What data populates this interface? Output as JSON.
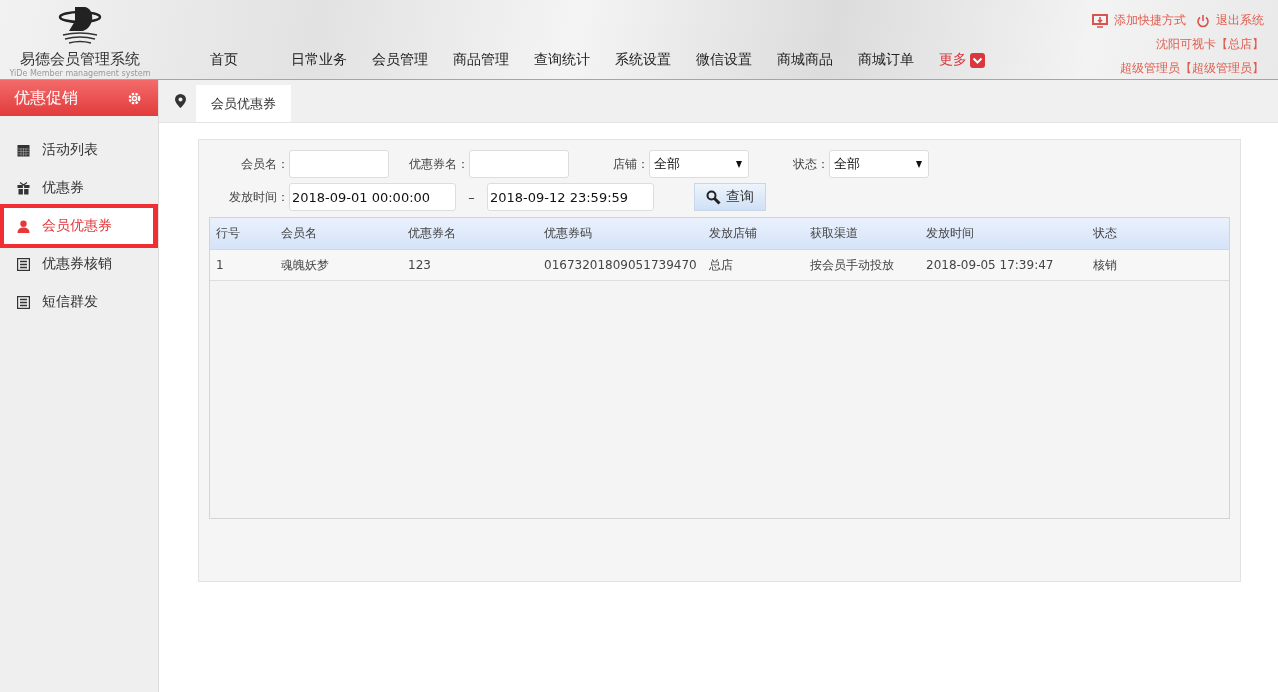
{
  "header": {
    "logo_title": "易德会员管理系统",
    "logo_subtitle": "YiDe Member management system",
    "nav": [
      {
        "label": "首页",
        "kind": "link"
      },
      {
        "label": "日常业务",
        "kind": "link"
      },
      {
        "label": "会员管理",
        "kind": "link"
      },
      {
        "label": "商品管理",
        "kind": "link"
      },
      {
        "label": "查询统计",
        "kind": "link"
      },
      {
        "label": "系统设置",
        "kind": "link"
      },
      {
        "label": "微信设置",
        "kind": "link"
      },
      {
        "label": "商城商品",
        "kind": "link"
      },
      {
        "label": "商城订单",
        "kind": "link"
      },
      {
        "label": "更多",
        "kind": "more"
      }
    ],
    "add_shortcut": "添加快捷方式",
    "logout": "退出系统",
    "store": "沈阳可视卡【总店】",
    "user": "超级管理员【超级管理员】"
  },
  "sidebar": {
    "title": "优惠促销",
    "items": [
      {
        "label": "活动列表",
        "kind": "calendar",
        "selected": false
      },
      {
        "label": "优惠券",
        "kind": "gift",
        "selected": false
      },
      {
        "label": "会员优惠券",
        "kind": "user",
        "selected": true
      },
      {
        "label": "优惠券核销",
        "kind": "list",
        "selected": false
      },
      {
        "label": "短信群发",
        "kind": "list",
        "selected": false
      }
    ]
  },
  "tabs": [
    {
      "label": "会员优惠券",
      "selected": true
    }
  ],
  "filters": {
    "member_label": "会员名：",
    "coupon_label": "优惠券名：",
    "store_label": "店铺：",
    "store_value": "全部",
    "status_label": "状态：",
    "status_value": "全部",
    "time_label": "发放时间：",
    "time_from": "2018-09-01 00:00:00",
    "time_sep": "–",
    "time_to": "2018-09-12 23:59:59",
    "search_button": "查询"
  },
  "table": {
    "columns": [
      "行号",
      "会员名",
      "优惠券名",
      "优惠券码",
      "发放店铺",
      "获取渠道",
      "发放时间",
      "状态"
    ],
    "rows": [
      [
        "1",
        "魂魄妖梦",
        "123",
        "01673201809051739470",
        "总店",
        "按会员手动投放",
        "2018-09-05 17:39:47",
        "核销"
      ]
    ]
  }
}
